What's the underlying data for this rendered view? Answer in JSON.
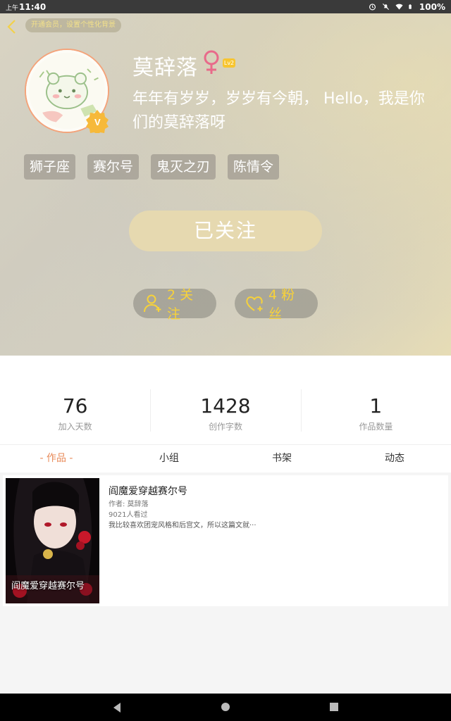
{
  "status_bar": {
    "ampm": "上午",
    "time": "11:40",
    "battery": "100%"
  },
  "header": {
    "vip_prompt": "开通会员，设置个性化背景",
    "nickname": "莫辞落",
    "level": "Lv2",
    "signature": "年年有岁岁，岁岁有今朝， Hello，我是你们的莫辞落呀",
    "tags": [
      "狮子座",
      "赛尔号",
      "鬼灭之刃",
      "陈情令"
    ],
    "follow_button": "已关注",
    "following_label": "2 关注",
    "fans_label": "4 粉丝"
  },
  "stats": [
    {
      "value": "76",
      "label": "加入天数"
    },
    {
      "value": "1428",
      "label": "创作字数"
    },
    {
      "value": "1",
      "label": "作品数量"
    }
  ],
  "tabs": [
    "- 作品 -",
    "小组",
    "书架",
    "动态"
  ],
  "works": [
    {
      "title": "阎魔爱穿越赛尔号",
      "author": "作者: 莫辞落",
      "views": "9021人看过",
      "description": "我比较喜欢团宠风格和后宫文，所以这篇文就···",
      "cover_text": "阎魔爱穿越赛尔号"
    }
  ],
  "colors": {
    "accent": "#e88b5a",
    "gold": "#f7d23a",
    "follow_button_bg": "#e6d9b0"
  }
}
